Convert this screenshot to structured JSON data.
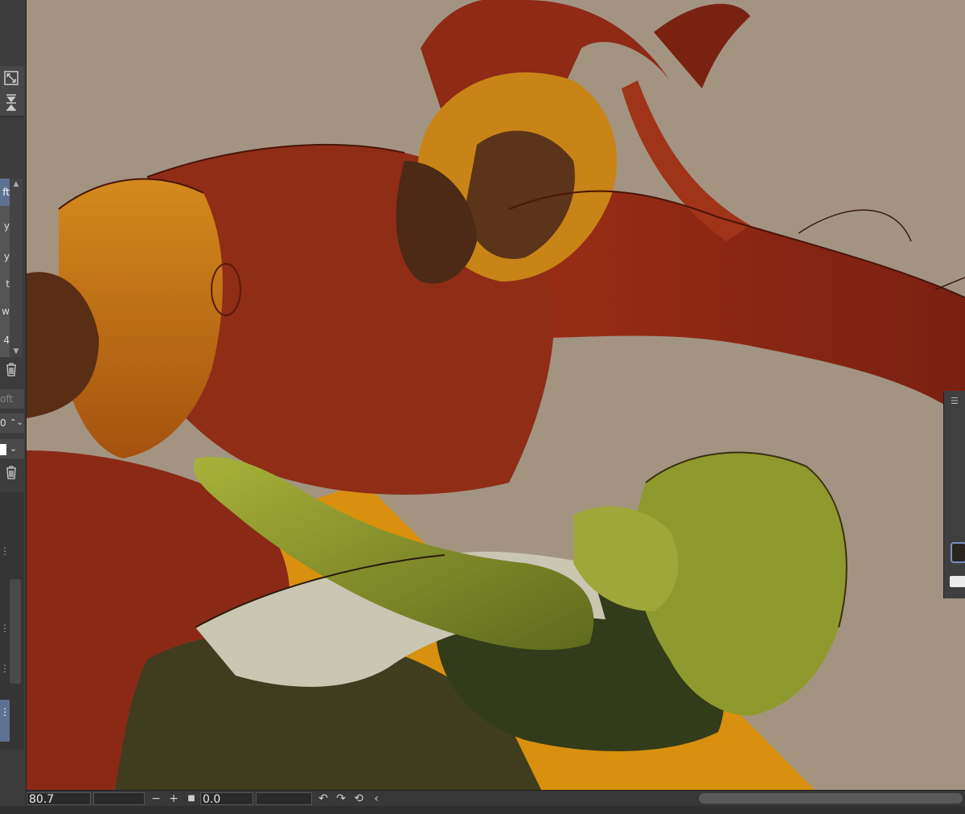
{
  "left_panel": {
    "tool_icons": [
      "expand-icon",
      "merge-down-icon"
    ],
    "list_items": [
      "ft",
      "y",
      "y",
      "t",
      "w",
      "4"
    ],
    "selected_index": 0,
    "field_label_1": "oft",
    "field_value": "0",
    "trash_icon": "trash-icon"
  },
  "statusbar": {
    "zoom_value": "80.7",
    "rotation_value": "0.0",
    "minus_label": "−",
    "plus_label": "+",
    "rotate_ccw_icon": "↶",
    "rotate_cw_icon": "↷",
    "reset_icon": "⟲",
    "collapse_icon": "‹",
    "stop_icon": "■"
  },
  "colors": {
    "canvas_background": "#a39482",
    "selection_blue": "#5f7192",
    "cape_red": "#8a2a17",
    "armor_orange": "#c97a14",
    "green_skin": "#8a9a2c"
  }
}
